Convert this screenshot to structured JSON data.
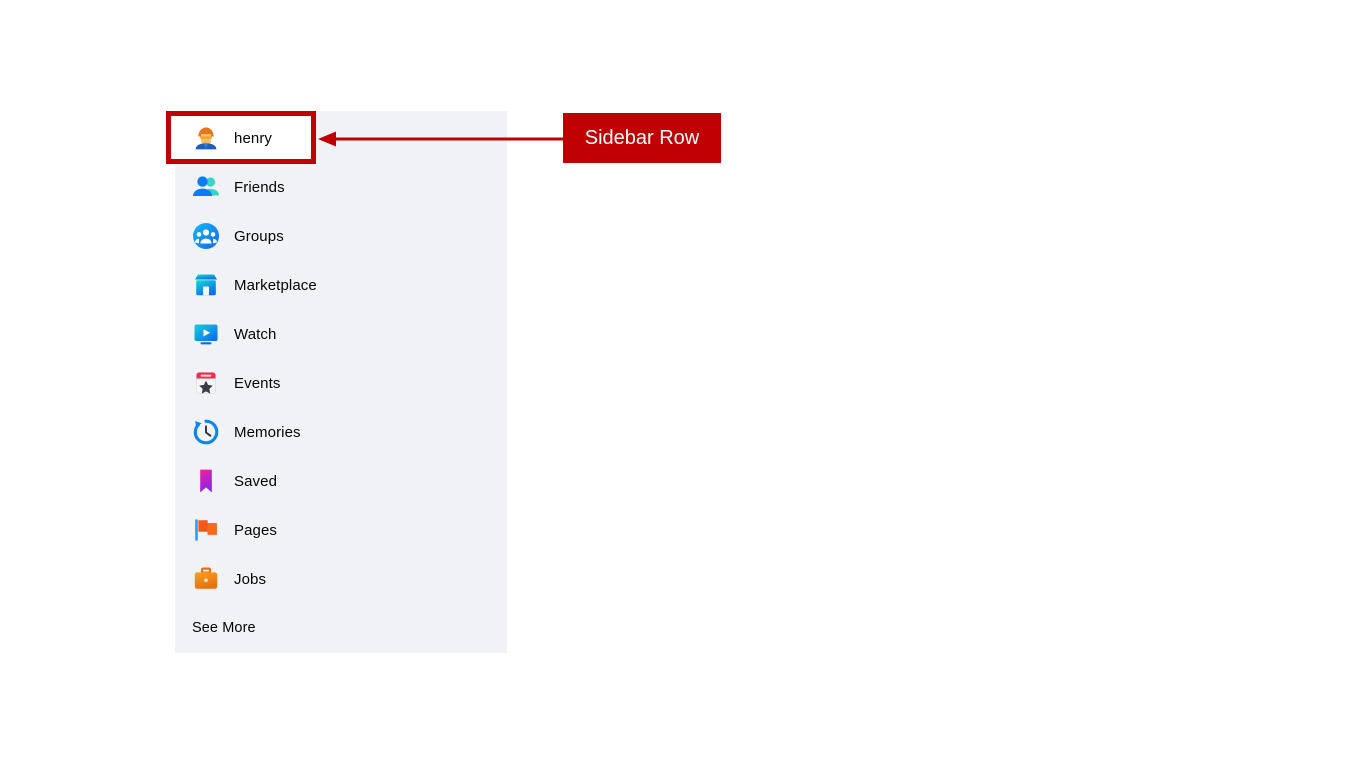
{
  "sidebar": {
    "background_color": "#f0f2f5",
    "items": [
      {
        "label": "henry",
        "icon": "avatar-icon",
        "highlighted": true
      },
      {
        "label": "Friends",
        "icon": "friends-icon",
        "highlighted": false
      },
      {
        "label": "Groups",
        "icon": "groups-icon",
        "highlighted": false
      },
      {
        "label": "Marketplace",
        "icon": "marketplace-icon",
        "highlighted": false
      },
      {
        "label": "Watch",
        "icon": "watch-icon",
        "highlighted": false
      },
      {
        "label": "Events",
        "icon": "events-icon",
        "highlighted": false
      },
      {
        "label": "Memories",
        "icon": "memories-icon",
        "highlighted": false
      },
      {
        "label": "Saved",
        "icon": "saved-icon",
        "highlighted": false
      },
      {
        "label": "Pages",
        "icon": "pages-icon",
        "highlighted": false
      },
      {
        "label": "Jobs",
        "icon": "jobs-icon",
        "highlighted": false
      }
    ],
    "see_more_label": "See More"
  },
  "annotation": {
    "label": "Sidebar Row",
    "color": "#c00000",
    "text_color": "#ffffff",
    "points_to": "henry"
  }
}
